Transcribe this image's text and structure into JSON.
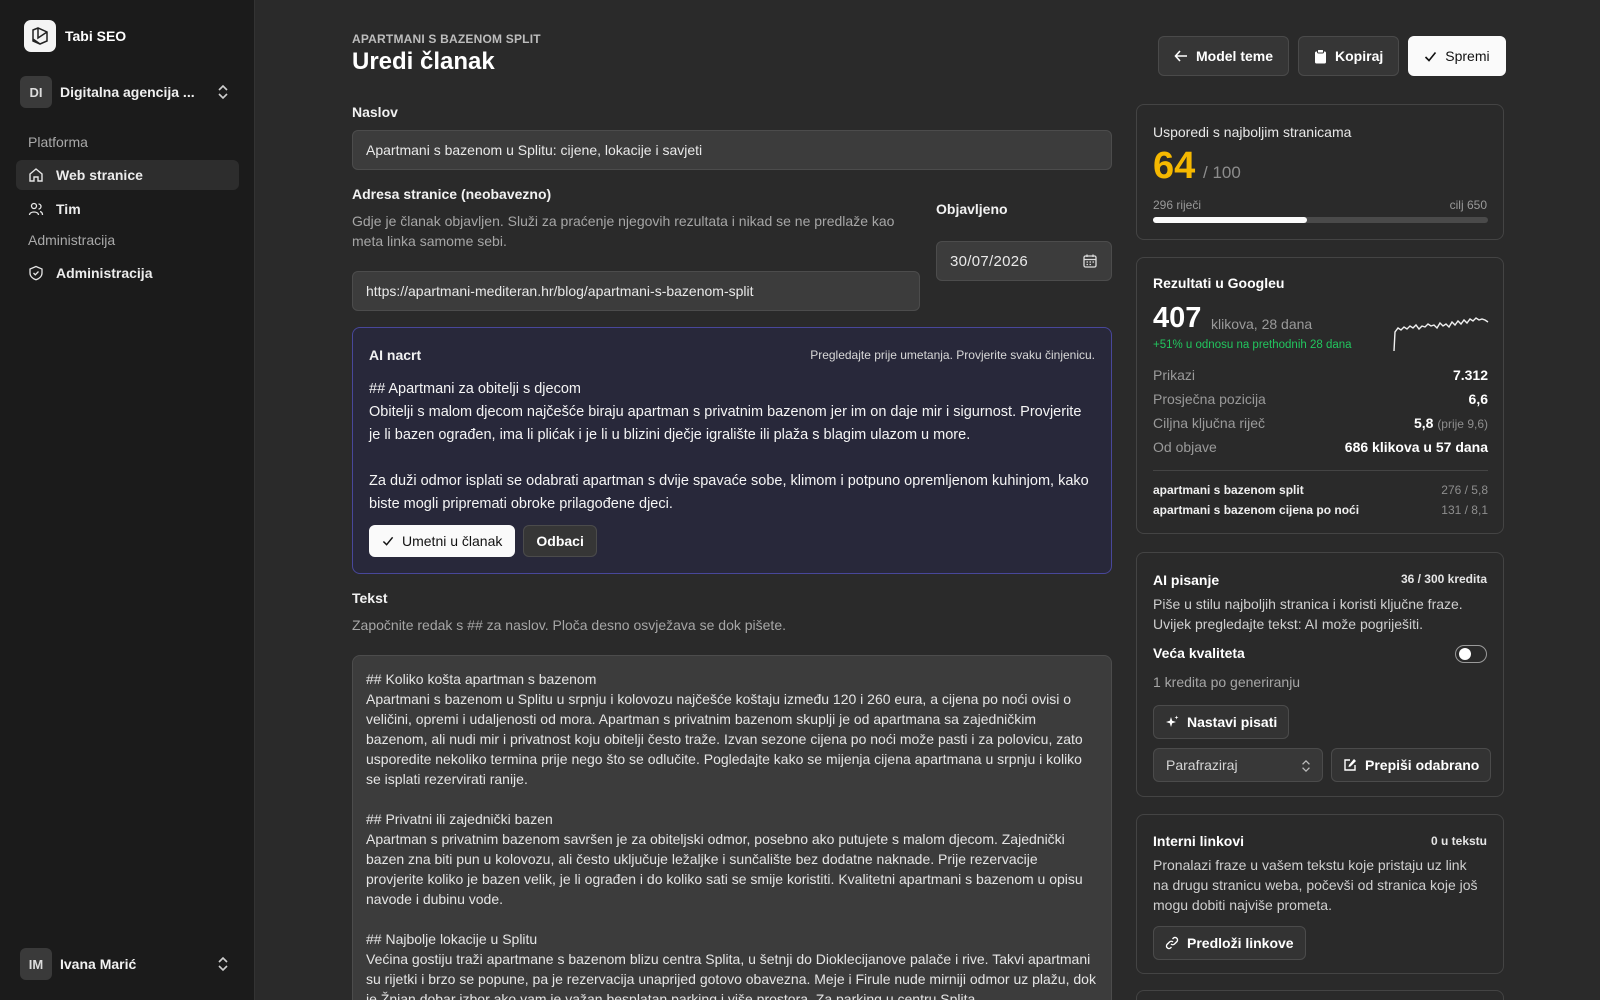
{
  "sidebar": {
    "brand": "Tabi SEO",
    "org": {
      "initials": "DI",
      "name": "Digitalna agencija ..."
    },
    "groups": [
      {
        "label": "Platforma"
      },
      {
        "label": "Administracija"
      }
    ],
    "items": [
      {
        "label": "Web stranice",
        "icon": "home-icon",
        "active": true
      },
      {
        "label": "Tim",
        "icon": "users-icon"
      },
      {
        "label": "Administracija",
        "icon": "shield-icon"
      }
    ],
    "user": {
      "initials": "IM",
      "name": "Ivana Marić"
    }
  },
  "header": {
    "eyebrow": "APARTMANI S BAZENOM SPLIT",
    "title": "Uredi članak",
    "actions": {
      "back": "Model teme",
      "copy": "Kopiraj",
      "save": "Spremi"
    }
  },
  "form": {
    "title_label": "Naslov",
    "title_value": "Apartmani s bazenom u Splitu: cijene, lokacije i savjeti",
    "url_label": "Adresa stranice (neobavezno)",
    "url_hint": "Gdje je članak objavljen. Služi za praćenje njegovih rezultata i nikad se ne predlaže kao meta linka samome sebi.",
    "url_value": "https://apartmani-mediteran.hr/blog/apartmani-s-bazenom-split",
    "published_label": "Objavljeno",
    "published_value": "30/07/2026",
    "text_label": "Tekst",
    "text_hint": "Započnite redak s ## za naslov. Ploča desno osvježava se dok pišete.",
    "text_paragraphs": [
      "## Koliko košta apartman s bazenom\nApartmani s bazenom u Splitu u srpnju i kolovozu najčešće koštaju između 120 i 260 eura, a cijena po noći ovisi o veličini, opremi i udaljenosti od mora. Apartman s privatnim bazenom skuplji je od apartmana sa zajedničkim bazenom, ali nudi mir i privatnost koju obitelji često traže. Izvan sezone cijena po noći može pasti i za polovicu, zato usporedite nekoliko termina prije nego što se odlučite. Pogledajte kako se mijenja cijena apartmana u srpnju i koliko se isplati rezervirati ranije.",
      "## Privatni ili zajednički bazen\nApartman s privatnim bazenom savršen je za obiteljski odmor, posebno ako putujete s malom djecom. Zajednički bazen zna biti pun u kolovozu, ali često uključuje ležaljke i sunčalište bez dodatne naknade. Prije rezervacije provjerite koliko je bazen velik, je li ograđen i do koliko sati se smije koristiti. Kvalitetni apartmani s bazenom u opisu navode i dubinu vode.",
      "## Najbolje lokacije u Splitu\nVećina gostiju traži apartmane s bazenom blizu centra Splita, u šetnji do Dioklecijanove palače i rive. Takvi apartmani su rijetki i brzo se popune, pa je rezervacija unaprijed gotovo obavezna. Meje i Firule nude mirniji odmor uz plažu, dok je Žnjan dobar izbor ako vam je važan besplatan parking i više prostora. Za parking u centru Splita"
    ]
  },
  "ai_draft": {
    "title": "AI nacrt",
    "note": "Pregledajte prije umetanja. Provjerite svaku činjenicu.",
    "heading": "## Apartmani za obitelji s djecom",
    "para1": "Obitelji s malom djecom najčešće biraju apartman s privatnim bazenom jer im on daje mir i sigurnost. Provjerite je li bazen ograđen, ima li plićak i je li u blizini dječje igralište ili plaža s blagim ulazom u more.",
    "para2": "Za duži odmor isplati se odabrati apartman s dvije spavaće sobe, klimom i potpuno opremljenom kuhinjom, kako biste mogli pripremati obroke prilagođene djeci.",
    "insert": "Umetni u članak",
    "reject": "Odbaci"
  },
  "score": {
    "title": "Usporedi s najboljim stranicama",
    "value": "64",
    "of": "/ 100",
    "words": "296 riječi",
    "target": "cilj 650",
    "progress_fraction": 0.46
  },
  "google": {
    "title": "Rezultati u Googleu",
    "clicks": "407",
    "clicks_label": "klikova, 28 dana",
    "change": "+51% u odnosu na prethodnih 28 dana",
    "metrics": [
      {
        "k": "Prikazi",
        "v": "7.312"
      },
      {
        "k": "Prosječna pozicija",
        "v": "6,6"
      },
      {
        "k": "Ciljna ključna riječ",
        "v": "5,8",
        "extra": "(prije 9,6)"
      },
      {
        "k": "Od objave",
        "v": "686 klikova u 57 dana"
      }
    ],
    "keywords": [
      {
        "k": "apartmani s bazenom split",
        "v": "276 / 5,8"
      },
      {
        "k": "apartmani s bazenom cijena po noći",
        "v": "131 / 8,1"
      }
    ]
  },
  "ai_writing": {
    "title": "AI pisanje",
    "credits": "36 / 300 kredita",
    "desc": "Piše u stilu najboljih stranica i koristi ključne fraze. Uvijek pregledajte tekst: AI može pogriješiti.",
    "quality_label": "Veća kvaliteta",
    "quality_on": false,
    "cost": "1 kredita po generiranju",
    "continue": "Nastavi pisati",
    "mode": "Parafraziraj",
    "rewrite": "Prepiši odabrano"
  },
  "links": {
    "title": "Interni linkovi",
    "count": "0 u tekstu",
    "desc": "Pronalazi fraze u vašem tekstu koje pristaju uz link na drugu stranicu weba, počevši od stranica koje još mogu dobiti najviše prometa.",
    "suggest": "Predloži linkove"
  },
  "colors": {
    "accent_score": "#f5b800",
    "positive": "#22c55e",
    "ai_border": "#48479a"
  }
}
